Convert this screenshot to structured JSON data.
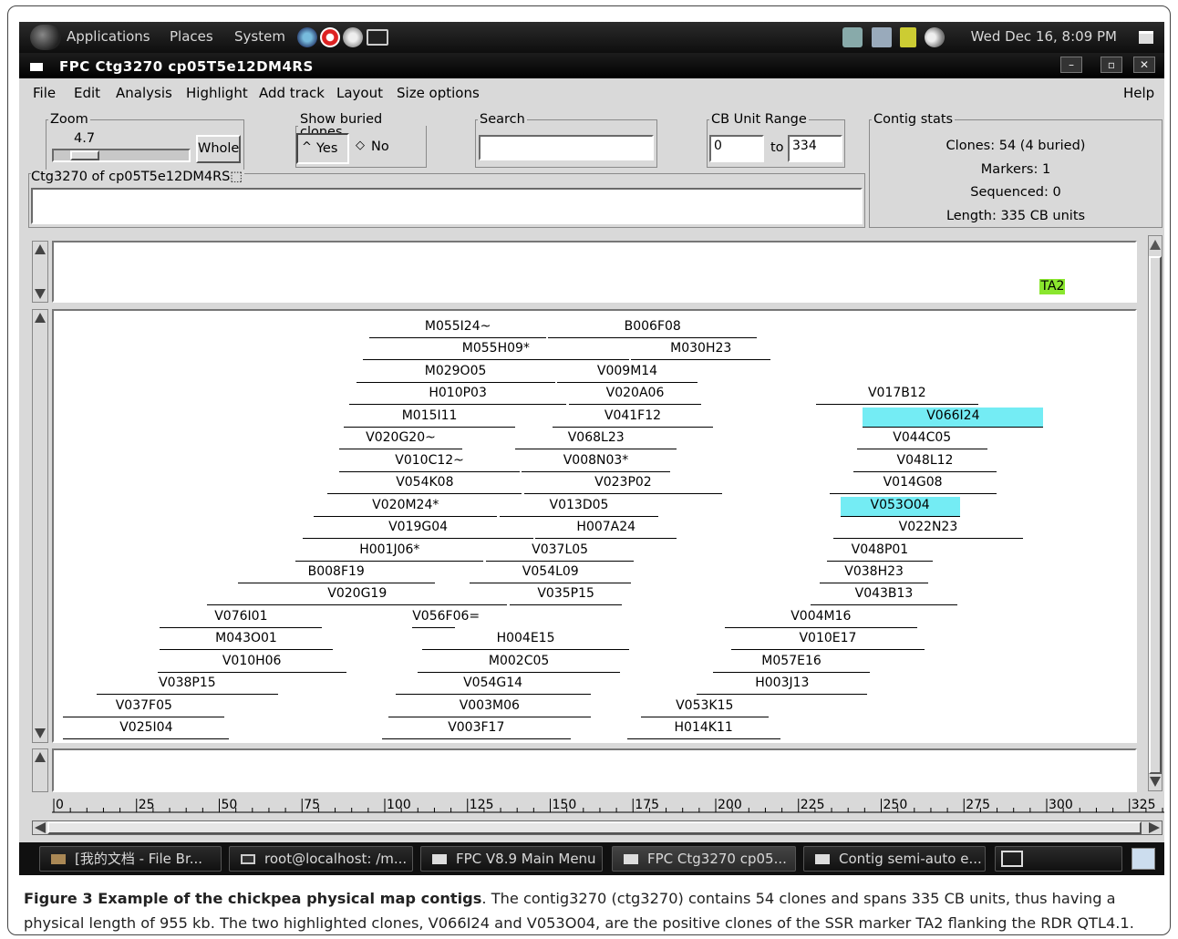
{
  "top_panel": {
    "menus": [
      "Applications",
      "Places",
      "System"
    ],
    "clock": "Wed Dec 16,  8:09 PM"
  },
  "window": {
    "title": "FPC Ctg3270 cp05T5e12DM4RS",
    "controls": [
      "–",
      "▫",
      "✕"
    ]
  },
  "menubar": [
    "File",
    "Edit",
    "Analysis",
    "Highlight",
    "Add track",
    "Layout",
    "Size options"
  ],
  "help_label": "Help",
  "zoom": {
    "legend": "Zoom",
    "value": "4.7",
    "slider_fraction": 0.12,
    "whole_label": "Whole"
  },
  "buried": {
    "legend": "Show buried clones",
    "yes_label": "Yes",
    "no_label": "No",
    "selected": "Yes"
  },
  "search": {
    "legend": "Search",
    "value": ""
  },
  "cb_range": {
    "legend": "CB Unit Range",
    "from": "0",
    "to_label": "to",
    "to": "334"
  },
  "contig_stats": {
    "legend": "Contig stats",
    "lines": [
      "Clones: 54 (4 buried)",
      "Markers: 1",
      "Sequenced: 0",
      "Length: 335 CB units"
    ]
  },
  "ctg_label": "Ctg3270 of cp05T5e12DM4RS⬚",
  "ctg_text": "",
  "marker": {
    "name": "TA2",
    "color": "#8ae62e"
  },
  "highlight_color": "#74ecf4",
  "clones": [
    {
      "name": "M055I24~",
      "start": 94.6,
      "end": 147.9,
      "row": 0
    },
    {
      "name": "B006F08",
      "start": 148.5,
      "end": 211.7,
      "row": 0
    },
    {
      "name": "M055H09*",
      "start": 92.6,
      "end": 172.9,
      "row": 1
    },
    {
      "name": "M030H23",
      "start": 173.6,
      "end": 215.8,
      "row": 1
    },
    {
      "name": "M029O05",
      "start": 90.5,
      "end": 150.6,
      "row": 2
    },
    {
      "name": "V009M14",
      "start": 151.3,
      "end": 193.6,
      "row": 2
    },
    {
      "name": "H010P03",
      "start": 88.5,
      "end": 154.0,
      "row": 3
    },
    {
      "name": "V020A06",
      "start": 154.7,
      "end": 194.9,
      "row": 3
    },
    {
      "name": "V017B12",
      "start": 229.5,
      "end": 278.4,
      "row": 3
    },
    {
      "name": "M015I11",
      "start": 86.8,
      "end": 138.6,
      "row": 4
    },
    {
      "name": "V041F12",
      "start": 149.9,
      "end": 198.3,
      "row": 4
    },
    {
      "name": "V066I24",
      "start": 243.6,
      "end": 298.2,
      "row": 4,
      "highlight": true
    },
    {
      "name": "V020G20~",
      "start": 85.4,
      "end": 122.6,
      "row": 5
    },
    {
      "name": "V068L23",
      "start": 138.6,
      "end": 187.4,
      "row": 5
    },
    {
      "name": "V044C05",
      "start": 241.8,
      "end": 281.2,
      "row": 5
    },
    {
      "name": "V010C12~",
      "start": 85.4,
      "end": 140.0,
      "row": 6
    },
    {
      "name": "V008N03*",
      "start": 140.6,
      "end": 185.3,
      "row": 6
    },
    {
      "name": "V048L12",
      "start": 240.9,
      "end": 283.9,
      "row": 6
    },
    {
      "name": "V054K08",
      "start": 81.9,
      "end": 140.6,
      "row": 7
    },
    {
      "name": "V023P02",
      "start": 141.3,
      "end": 201.1,
      "row": 7
    },
    {
      "name": "V014G08",
      "start": 233.5,
      "end": 283.9,
      "row": 7
    },
    {
      "name": "V020M24*",
      "start": 77.8,
      "end": 133.1,
      "row": 8
    },
    {
      "name": "V013D05",
      "start": 133.8,
      "end": 181.9,
      "row": 8
    },
    {
      "name": "V053O04",
      "start": 236.8,
      "end": 272.9,
      "row": 8,
      "highlight": true
    },
    {
      "name": "V019G04",
      "start": 74.4,
      "end": 144.1,
      "row": 9
    },
    {
      "name": "H007A24",
      "start": 144.7,
      "end": 187.4,
      "row": 9
    },
    {
      "name": "V022N23",
      "start": 234.7,
      "end": 292.0,
      "row": 9
    },
    {
      "name": "H001J06*",
      "start": 72.3,
      "end": 129.0,
      "row": 10
    },
    {
      "name": "V037L05",
      "start": 129.7,
      "end": 174.5,
      "row": 10
    },
    {
      "name": "V048P01",
      "start": 232.7,
      "end": 264.8,
      "row": 10
    },
    {
      "name": "B008F19",
      "start": 54.8,
      "end": 114.2,
      "row": 11
    },
    {
      "name": "V054L09",
      "start": 124.9,
      "end": 173.6,
      "row": 11
    },
    {
      "name": "V038H23",
      "start": 230.6,
      "end": 263.4,
      "row": 11
    },
    {
      "name": "V020G19",
      "start": 45.5,
      "end": 136.2,
      "row": 12
    },
    {
      "name": "V035P15",
      "start": 136.9,
      "end": 170.9,
      "row": 12
    },
    {
      "name": "V043B13",
      "start": 227.8,
      "end": 272.2,
      "row": 12
    },
    {
      "name": "V076I01",
      "start": 31.2,
      "end": 80.3,
      "row": 13
    },
    {
      "name": "V056F06=",
      "start": 107.5,
      "end": 120.3,
      "row": 13
    },
    {
      "name": "V004M16",
      "start": 201.8,
      "end": 260.1,
      "row": 13
    },
    {
      "name": "M043O01",
      "start": 31.2,
      "end": 83.4,
      "row": 14
    },
    {
      "name": "H004E15",
      "start": 110.6,
      "end": 172.9,
      "row": 14
    },
    {
      "name": "V010E17",
      "start": 203.9,
      "end": 262.2,
      "row": 14
    },
    {
      "name": "V010H06",
      "start": 30.5,
      "end": 87.5,
      "row": 15
    },
    {
      "name": "M002C05",
      "start": 109.2,
      "end": 170.2,
      "row": 15
    },
    {
      "name": "M057E16",
      "start": 198.4,
      "end": 245.7,
      "row": 15
    },
    {
      "name": "V038P15",
      "start": 12.0,
      "end": 67.0,
      "row": 16
    },
    {
      "name": "V054G14",
      "start": 102.4,
      "end": 161.3,
      "row": 16
    },
    {
      "name": "H003J13",
      "start": 193.5,
      "end": 245.0,
      "row": 16
    },
    {
      "name": "V037F05",
      "start": 2.0,
      "end": 50.8,
      "row": 17
    },
    {
      "name": "V003M06",
      "start": 100.3,
      "end": 161.3,
      "row": 17
    },
    {
      "name": "V053K15",
      "start": 176.5,
      "end": 215.1,
      "row": 17
    },
    {
      "name": "V025I04",
      "start": 2.0,
      "end": 52.2,
      "row": 18
    },
    {
      "name": "V003F17",
      "start": 98.3,
      "end": 155.3,
      "row": 18
    },
    {
      "name": "H014K11",
      "start": 172.4,
      "end": 218.6,
      "row": 18
    }
  ],
  "marker_position": 301.5,
  "ruler": {
    "labels": [
      "0",
      "25",
      "50",
      "75",
      "100",
      "125",
      "150",
      "175",
      "200",
      "225",
      "250",
      "275",
      "300",
      "325"
    ]
  },
  "taskbar": [
    "[我的文档  - File Br...",
    "root@localhost: /m...",
    "FPC V8.9 Main Menu",
    "FPC Ctg3270 cp05...",
    "Contig semi-auto e..."
  ],
  "caption": {
    "bold": "Figure 3 Example of the chickpea physical map contigs",
    "text": ". The contig3270 (ctg3270) contains 54 clones and spans 335 CB units, thus having a physical length of 955 kb. The two highlighted clones, V066I24 and V053O04, are the positive clones of the SSR marker TA2 flanking the RDR QTL4.1."
  }
}
